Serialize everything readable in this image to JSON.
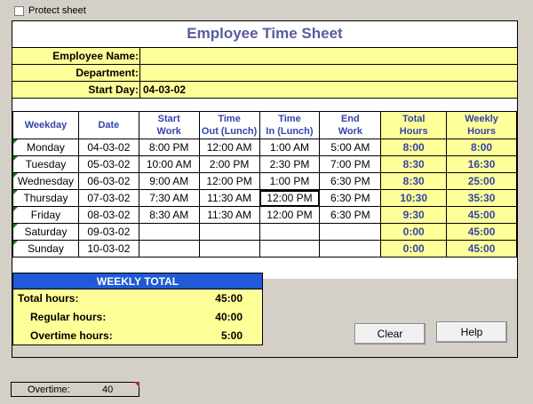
{
  "toolbar": {
    "protect_label": "Protect sheet",
    "protect_checked": false
  },
  "title": "Employee Time Sheet",
  "info": {
    "employee_name_label": "Employee Name:",
    "employee_name_value": "",
    "department_label": "Department:",
    "department_value": "",
    "start_day_label": "Start Day:",
    "start_day_value": "04-03-02"
  },
  "table": {
    "headers": [
      "Weekday",
      "Date",
      "Start Work",
      "Time Out (Lunch)",
      "Time In (Lunch)",
      "End Work",
      "Total Hours",
      "Weekly Hours"
    ],
    "rows": [
      {
        "weekday": "Monday",
        "date": "04-03-02",
        "start": "8:00 PM",
        "out": "12:00 AM",
        "in": "1:00 AM",
        "end": "5:00 AM",
        "total": "8:00",
        "weekly": "8:00"
      },
      {
        "weekday": "Tuesday",
        "date": "05-03-02",
        "start": "10:00 AM",
        "out": "2:00 PM",
        "in": "2:30 PM",
        "end": "7:00 PM",
        "total": "8:30",
        "weekly": "16:30"
      },
      {
        "weekday": "Wednesday",
        "date": "06-03-02",
        "start": "9:00 AM",
        "out": "12:00 PM",
        "in": "1:00 PM",
        "end": "6:30 PM",
        "total": "8:30",
        "weekly": "25:00"
      },
      {
        "weekday": "Thursday",
        "date": "07-03-02",
        "start": "7:30 AM",
        "out": "11:30 AM",
        "in": "12:00 PM",
        "end": "6:30 PM",
        "total": "10:30",
        "weekly": "35:30"
      },
      {
        "weekday": "Friday",
        "date": "08-03-02",
        "start": "8:30 AM",
        "out": "11:30 AM",
        "in": "12:00 PM",
        "end": "6:30 PM",
        "total": "9:30",
        "weekly": "45:00"
      },
      {
        "weekday": "Saturday",
        "date": "09-03-02",
        "start": "",
        "out": "",
        "in": "",
        "end": "",
        "total": "0:00",
        "weekly": "45:00"
      },
      {
        "weekday": "Sunday",
        "date": "10-03-02",
        "start": "",
        "out": "",
        "in": "",
        "end": "",
        "total": "0:00",
        "weekly": "45:00"
      }
    ]
  },
  "weekly_total": {
    "header": "WEEKLY TOTAL",
    "total_label": "Total hours:",
    "total_value": "45:00",
    "regular_label": "Regular hours:",
    "regular_value": "40:00",
    "overtime_label": "Overtime hours:",
    "overtime_value": "5:00"
  },
  "buttons": {
    "clear": "Clear",
    "help": "Help"
  },
  "status": {
    "label": "Overtime:",
    "value": "40"
  },
  "colors": {
    "title": "#5a5aa0",
    "header_text": "#3344aa",
    "highlight": "#ffff99",
    "weekly_header": "#1f5bd6"
  }
}
